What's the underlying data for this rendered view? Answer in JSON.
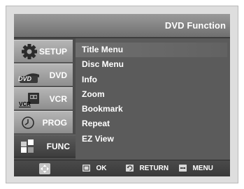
{
  "header": {
    "title": "DVD Function"
  },
  "sidebar": {
    "tabs": [
      {
        "label": "SETUP",
        "icon": "gear-icon"
      },
      {
        "label": "DVD",
        "icon": "dvd-disc-icon",
        "icon_text": "DVD"
      },
      {
        "label": "VCR",
        "icon": "vcr-tape-icon",
        "icon_text": "VCR"
      },
      {
        "label": "PROG",
        "icon": "clock-icon"
      },
      {
        "label": "FUNC",
        "icon": "function-blocks-icon"
      }
    ],
    "active": "FUNC"
  },
  "menu": {
    "items": [
      "Title Menu",
      "Disc Menu",
      "Info",
      "Zoom",
      "Bookmark",
      "Repeat",
      "EZ View"
    ],
    "selected": "Title Menu"
  },
  "footer": {
    "nav_icon": "dpad-icon",
    "ok_label": "OK",
    "return_label": "RETURN",
    "menu_label": "MENU"
  }
}
